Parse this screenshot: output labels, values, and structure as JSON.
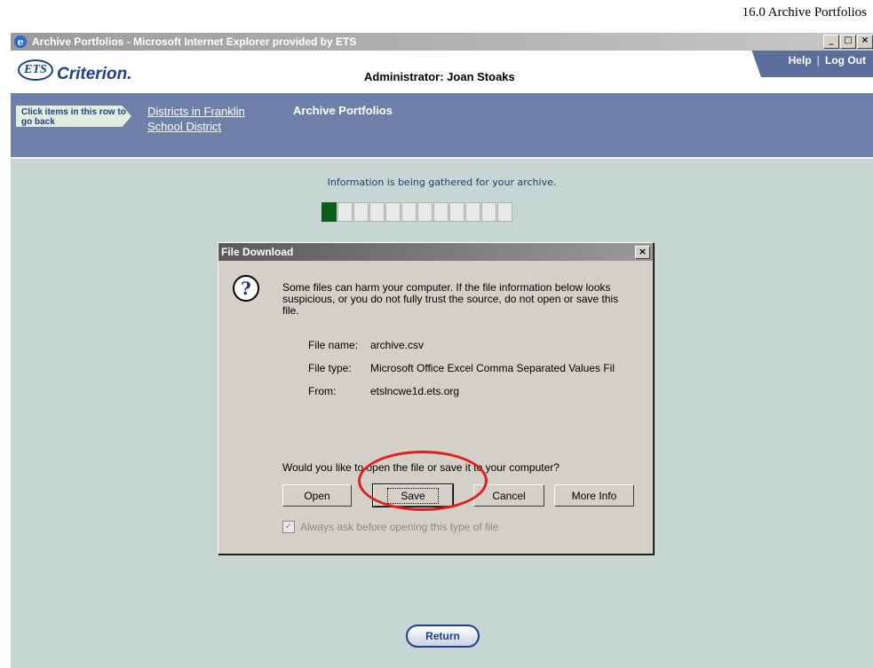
{
  "page_heading": "16.0 Archive Portfolios",
  "window": {
    "title": "Archive Portfolios - Microsoft Internet Explorer provided by ETS",
    "controls": [
      "_",
      "□",
      "×"
    ]
  },
  "header": {
    "logo_ets": "ETS",
    "logo_product": "Criterion.",
    "admin_label": "Administrator: Joan Stoaks",
    "help_link": "Help",
    "separator": "|",
    "logout_link": "Log Out"
  },
  "breadcrumb": {
    "hint": "Click items in this row to go back",
    "link": "Districts in Franklin School District",
    "current": "Archive Portfolios"
  },
  "content": {
    "status_text": "Information is being gathered for your archive.",
    "progress": {
      "filled": 1,
      "total": 12
    }
  },
  "dialog": {
    "title": "File Download",
    "close": "×",
    "icon": "?",
    "warning": "Some files can harm your computer. If the file information below looks suspicious, or you do not fully trust the source, do not open or save this file.",
    "file_name_label": "File name:",
    "file_name": "archive.csv",
    "file_type_label": "File type:",
    "file_type": "Microsoft Office Excel Comma Separated Values Fil",
    "from_label": "From:",
    "from": "etslncwe1d.ets.org",
    "question": "Would you like to open the file or save it to your computer?",
    "buttons": {
      "open": "Open",
      "save": "Save",
      "cancel": "Cancel",
      "more_info": "More Info"
    },
    "checkbox_label": "Always ask before opening this type of file",
    "checkbox_checked": true
  },
  "return_button": "Return",
  "colors": {
    "highlight": "#e02020",
    "progress_fill": "#0c5c1c",
    "brand": "#1d3f8c"
  }
}
